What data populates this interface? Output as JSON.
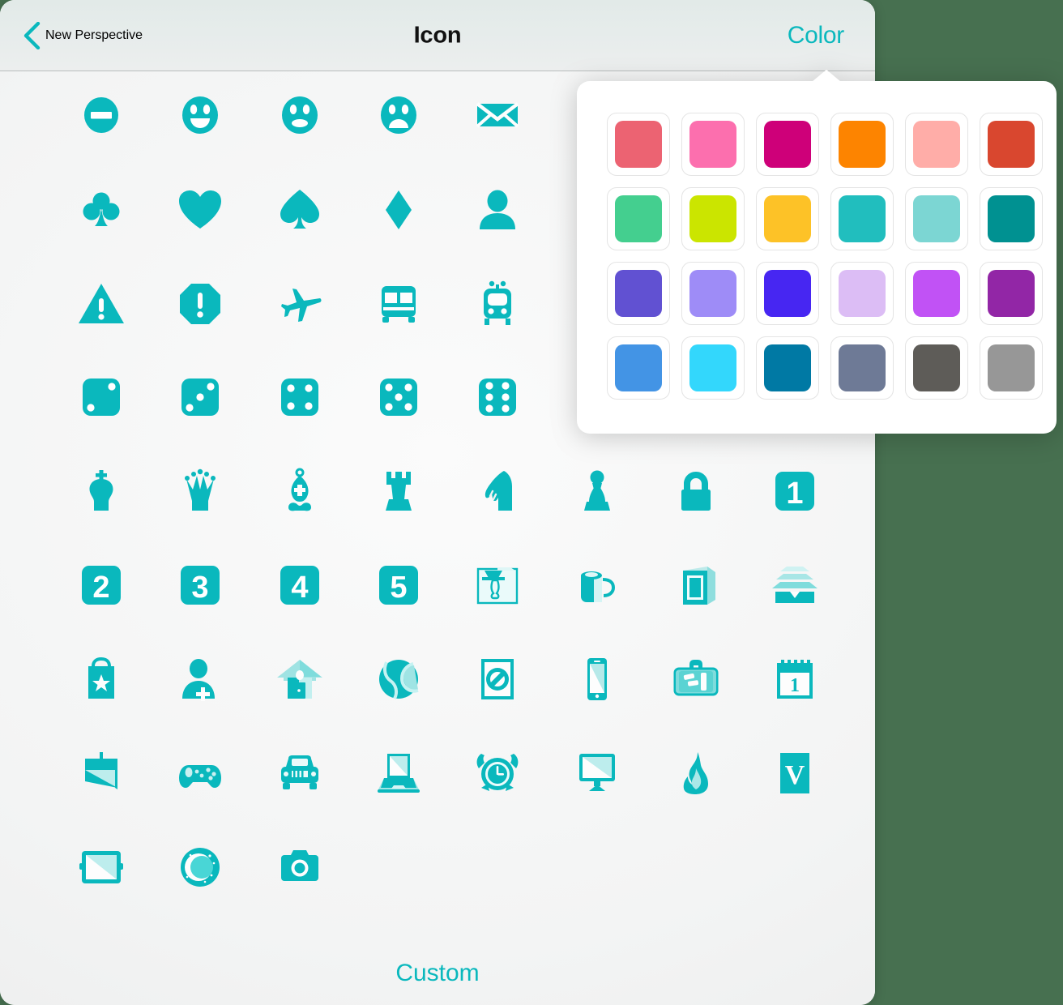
{
  "theme": {
    "accent": "#0ab8bd",
    "accent_dark": "#00a6ac",
    "background": "#477050",
    "panel": "#fbfbfb",
    "title_color": "#111111"
  },
  "header": {
    "back_label": "New Perspective",
    "back_icon": "chevron-left-icon",
    "title": "Icon",
    "color_label": "Color"
  },
  "footer": {
    "custom_label": "Custom"
  },
  "icon_grid": {
    "columns_small": 5,
    "columns_large": 8,
    "rows": [
      {
        "count": 5,
        "icons": [
          "no-entry-icon",
          "smiley-happy-icon",
          "smiley-neutral-icon",
          "smiley-sad-icon",
          "envelope-icon"
        ]
      },
      {
        "count": 5,
        "icons": [
          "club-suit-icon",
          "heart-suit-icon",
          "spade-suit-icon",
          "diamond-suit-icon",
          "person-icon"
        ]
      },
      {
        "count": 5,
        "icons": [
          "warning-triangle-icon",
          "exclamation-octagon-icon",
          "airplane-icon",
          "bus-icon",
          "train-icon"
        ]
      },
      {
        "count": 5,
        "icons": [
          "die-two-icon",
          "die-three-icon",
          "die-four-icon",
          "die-five-icon",
          "die-six-icon"
        ]
      },
      {
        "count": 8,
        "icons": [
          "chess-king-icon",
          "chess-queen-icon",
          "chess-bishop-icon",
          "chess-rook-icon",
          "chess-knight-icon",
          "chess-pawn-icon",
          "lock-icon",
          "number-one-box-icon"
        ]
      },
      {
        "count": 8,
        "icons": [
          "number-two-box-icon",
          "number-three-box-icon",
          "number-four-box-icon",
          "number-five-box-icon",
          "desk-lamp-icon",
          "mug-icon",
          "book-icon",
          "inbox-tray-icon"
        ]
      },
      {
        "count": 8,
        "icons": [
          "shopping-bag-star-icon",
          "add-person-icon",
          "house-icon",
          "tennis-ball-icon",
          "no-sign-document-icon",
          "phone-icon",
          "suitcase-icon",
          "calendar-one-icon"
        ]
      },
      {
        "count": 8,
        "icons": [
          "mouse-icon",
          "gamepad-icon",
          "car-icon",
          "laptop-icon",
          "alarm-clock-icon",
          "monitor-icon",
          "flame-icon",
          "letter-v-box-icon"
        ]
      },
      {
        "count": 3,
        "icons": [
          "tablet-icon",
          "moon-icon",
          "camera-icon"
        ]
      }
    ],
    "numeric_labels": {
      "one": "1",
      "two": "2",
      "three": "3",
      "four": "4",
      "five": "5",
      "calendar_day": "1",
      "letter": "V"
    }
  },
  "color_popover": {
    "visible": true,
    "rows": 4,
    "columns": 6,
    "swatches": [
      {
        "name": "salmon-red",
        "hex": "#EC6372"
      },
      {
        "name": "hot-pink",
        "hex": "#FC6FAE"
      },
      {
        "name": "magenta",
        "hex": "#CE0079"
      },
      {
        "name": "orange",
        "hex": "#FD8400"
      },
      {
        "name": "light-salmon",
        "hex": "#FFADA8"
      },
      {
        "name": "brick-red",
        "hex": "#D9472F"
      },
      {
        "name": "emerald-green",
        "hex": "#44CF8F"
      },
      {
        "name": "lime",
        "hex": "#CBE500"
      },
      {
        "name": "amber-yellow",
        "hex": "#FDC227"
      },
      {
        "name": "teal",
        "hex": "#21BEBE"
      },
      {
        "name": "light-teal",
        "hex": "#7CD6D3"
      },
      {
        "name": "dark-teal",
        "hex": "#009191"
      },
      {
        "name": "indigo-purple",
        "hex": "#6151D2"
      },
      {
        "name": "light-purple",
        "hex": "#9E8CF7"
      },
      {
        "name": "blue-violet",
        "hex": "#4726F2"
      },
      {
        "name": "lavender",
        "hex": "#DCBDF5"
      },
      {
        "name": "orchid",
        "hex": "#C152F5"
      },
      {
        "name": "dark-purple",
        "hex": "#9226A6"
      },
      {
        "name": "blue",
        "hex": "#4394E5"
      },
      {
        "name": "cyan",
        "hex": "#33D7FC"
      },
      {
        "name": "deep-blue",
        "hex": "#0079A4"
      },
      {
        "name": "slate-gray",
        "hex": "#6E7A96"
      },
      {
        "name": "dark-gray",
        "hex": "#5E5C58"
      },
      {
        "name": "medium-gray",
        "hex": "#979797"
      }
    ]
  }
}
